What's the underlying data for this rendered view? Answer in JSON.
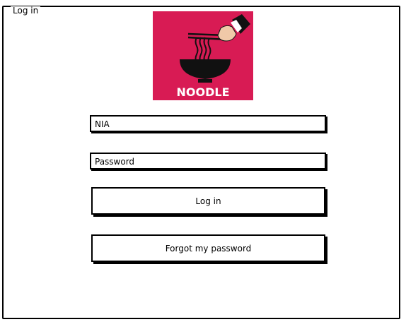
{
  "window": {
    "title": "Log in"
  },
  "logo": {
    "text": "NOODLE",
    "background_color": "#d81b54",
    "icon": "noodle-bowl-icon"
  },
  "form": {
    "nia_placeholder": "NIA",
    "password_placeholder": "Password",
    "login_label": "Log in",
    "forgot_label": "Forgot my password"
  }
}
